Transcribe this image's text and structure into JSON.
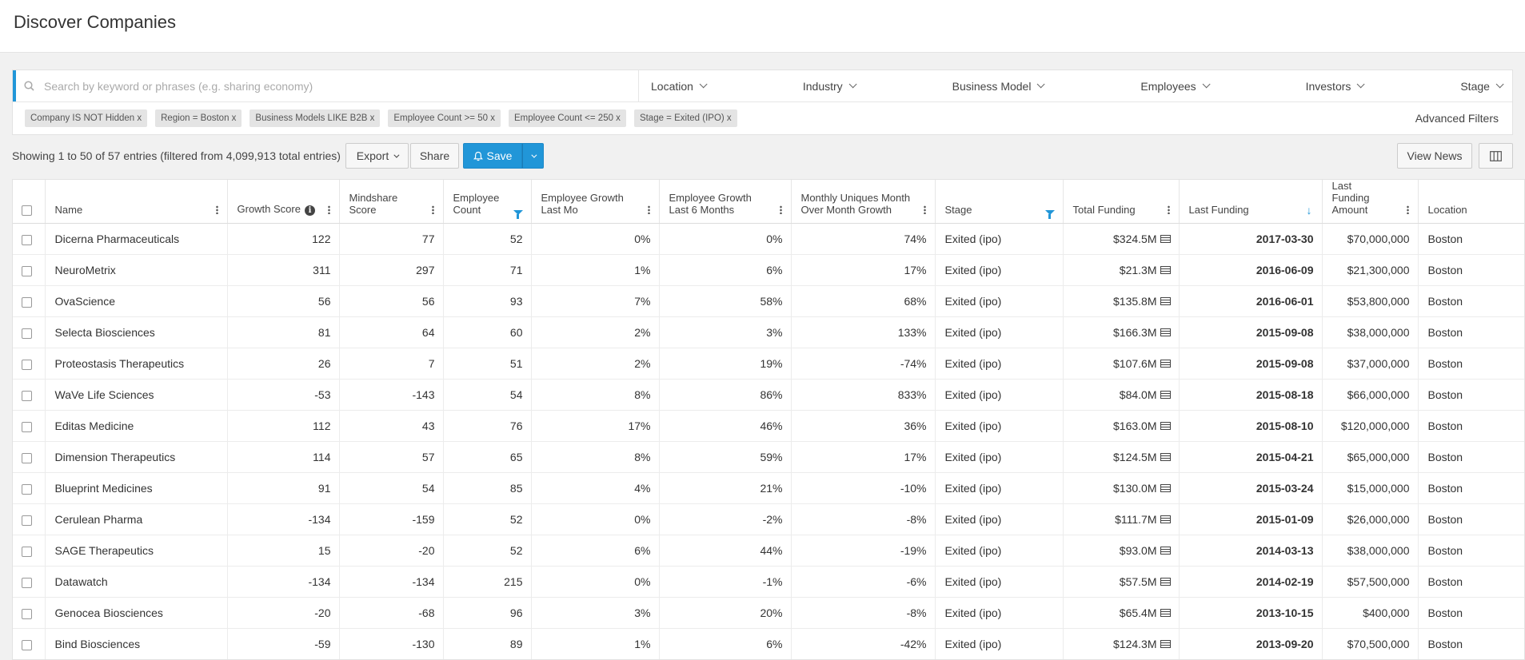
{
  "page_title": "Discover Companies",
  "search": {
    "placeholder": "Search by keyword or phrases (e.g. sharing economy)",
    "icon": "search-icon"
  },
  "filter_dropdowns": [
    "Location",
    "Industry",
    "Business Model",
    "Employees",
    "Investors",
    "Stage"
  ],
  "active_filters": [
    "Company IS NOT Hidden x",
    "Region = Boston x",
    "Business Models LIKE B2B x",
    "Employee Count >= 50 x",
    "Employee Count <= 250 x",
    "Stage = Exited (IPO) x"
  ],
  "advanced_filters_label": "Advanced Filters",
  "toolbar": {
    "entries_text": "Showing 1 to 50 of 57 entries (filtered from 4,099,913 total entries)",
    "export_label": "Export",
    "share_label": "Share",
    "save_label": "Save",
    "view_news_label": "View News"
  },
  "colors": {
    "accent": "#2196d8"
  },
  "table": {
    "columns": [
      {
        "label": "",
        "type": "checkbox"
      },
      {
        "label": "Name",
        "icon": "kebab"
      },
      {
        "label": "Growth Score",
        "icon": "kebab",
        "info": true
      },
      {
        "label": "Mindshare Score",
        "icon": "kebab"
      },
      {
        "label": "Employee Count",
        "icon": "filter"
      },
      {
        "label": "Employee Growth Last Mo",
        "icon": "kebab"
      },
      {
        "label": "Employee Growth Last 6 Months",
        "icon": "kebab"
      },
      {
        "label": "Monthly Uniques Month Over Month Growth",
        "icon": "kebab"
      },
      {
        "label": "Stage",
        "icon": "filter"
      },
      {
        "label": "Total Funding",
        "icon": "kebab"
      },
      {
        "label": "Last Funding",
        "icon": "sort-desc"
      },
      {
        "label": "Last Funding Amount",
        "icon": "kebab"
      },
      {
        "label": "Location",
        "icon": ""
      }
    ],
    "rows": [
      [
        "Dicerna Pharmaceuticals",
        "122",
        "77",
        "52",
        "0%",
        "0%",
        "74%",
        "Exited (ipo)",
        "$324.5M",
        "2017-03-30",
        "$70,000,000",
        "Boston"
      ],
      [
        "NeuroMetrix",
        "311",
        "297",
        "71",
        "1%",
        "6%",
        "17%",
        "Exited (ipo)",
        "$21.3M",
        "2016-06-09",
        "$21,300,000",
        "Boston"
      ],
      [
        "OvaScience",
        "56",
        "56",
        "93",
        "7%",
        "58%",
        "68%",
        "Exited (ipo)",
        "$135.8M",
        "2016-06-01",
        "$53,800,000",
        "Boston"
      ],
      [
        "Selecta Biosciences",
        "81",
        "64",
        "60",
        "2%",
        "3%",
        "133%",
        "Exited (ipo)",
        "$166.3M",
        "2015-09-08",
        "$38,000,000",
        "Boston"
      ],
      [
        "Proteostasis Therapeutics",
        "26",
        "7",
        "51",
        "2%",
        "19%",
        "-74%",
        "Exited (ipo)",
        "$107.6M",
        "2015-09-08",
        "$37,000,000",
        "Boston"
      ],
      [
        "WaVe Life Sciences",
        "-53",
        "-143",
        "54",
        "8%",
        "86%",
        "833%",
        "Exited (ipo)",
        "$84.0M",
        "2015-08-18",
        "$66,000,000",
        "Boston"
      ],
      [
        "Editas Medicine",
        "112",
        "43",
        "76",
        "17%",
        "46%",
        "36%",
        "Exited (ipo)",
        "$163.0M",
        "2015-08-10",
        "$120,000,000",
        "Boston"
      ],
      [
        "Dimension Therapeutics",
        "114",
        "57",
        "65",
        "8%",
        "59%",
        "17%",
        "Exited (ipo)",
        "$124.5M",
        "2015-04-21",
        "$65,000,000",
        "Boston"
      ],
      [
        "Blueprint Medicines",
        "91",
        "54",
        "85",
        "4%",
        "21%",
        "-10%",
        "Exited (ipo)",
        "$130.0M",
        "2015-03-24",
        "$15,000,000",
        "Boston"
      ],
      [
        "Cerulean Pharma",
        "-134",
        "-159",
        "52",
        "0%",
        "-2%",
        "-8%",
        "Exited (ipo)",
        "$111.7M",
        "2015-01-09",
        "$26,000,000",
        "Boston"
      ],
      [
        "SAGE Therapeutics",
        "15",
        "-20",
        "52",
        "6%",
        "44%",
        "-19%",
        "Exited (ipo)",
        "$93.0M",
        "2014-03-13",
        "$38,000,000",
        "Boston"
      ],
      [
        "Datawatch",
        "-134",
        "-134",
        "215",
        "0%",
        "-1%",
        "-6%",
        "Exited (ipo)",
        "$57.5M",
        "2014-02-19",
        "$57,500,000",
        "Boston"
      ],
      [
        "Genocea Biosciences",
        "-20",
        "-68",
        "96",
        "3%",
        "20%",
        "-8%",
        "Exited (ipo)",
        "$65.4M",
        "2013-10-15",
        "$400,000",
        "Boston"
      ],
      [
        "Bind Biosciences",
        "-59",
        "-130",
        "89",
        "1%",
        "6%",
        "-42%",
        "Exited (ipo)",
        "$124.3M",
        "2013-09-20",
        "$70,500,000",
        "Boston"
      ]
    ]
  }
}
